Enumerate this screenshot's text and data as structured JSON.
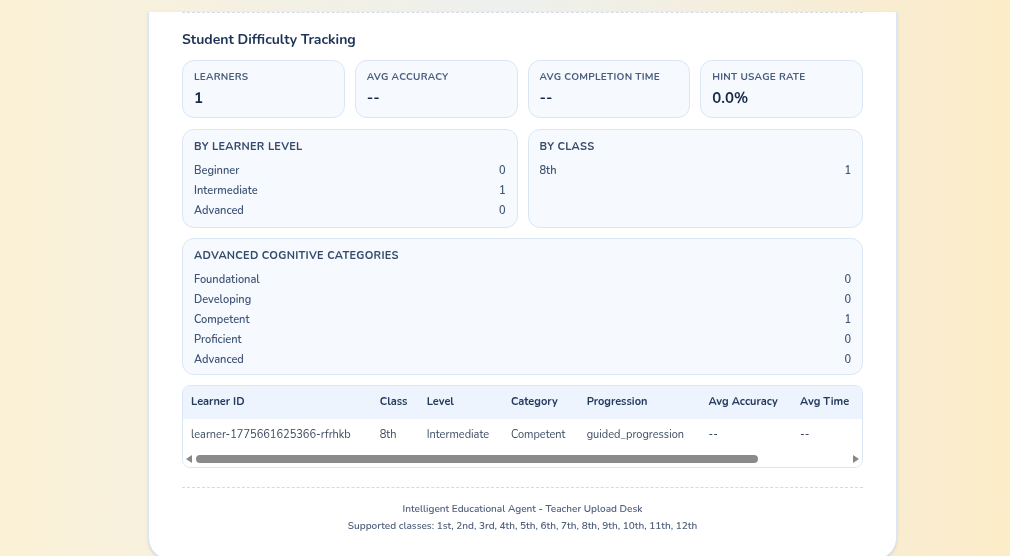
{
  "section_title": "Student Difficulty Tracking",
  "stats": [
    {
      "label": "LEARNERS",
      "value": "1"
    },
    {
      "label": "AVG ACCURACY",
      "value": "--"
    },
    {
      "label": "AVG COMPLETION TIME",
      "value": "--"
    },
    {
      "label": "HINT USAGE RATE",
      "value": "0.0%"
    }
  ],
  "by_learner_level": {
    "title": "BY LEARNER LEVEL",
    "rows": [
      {
        "label": "Beginner",
        "count": "0"
      },
      {
        "label": "Intermediate",
        "count": "1"
      },
      {
        "label": "Advanced",
        "count": "0"
      }
    ]
  },
  "by_class": {
    "title": "BY CLASS",
    "rows": [
      {
        "label": "8th",
        "count": "1"
      }
    ]
  },
  "cognitive_categories": {
    "title": "ADVANCED COGNITIVE CATEGORIES",
    "rows": [
      {
        "label": "Foundational",
        "count": "0"
      },
      {
        "label": "Developing",
        "count": "0"
      },
      {
        "label": "Competent",
        "count": "1"
      },
      {
        "label": "Proficient",
        "count": "0"
      },
      {
        "label": "Advanced",
        "count": "0"
      }
    ]
  },
  "table": {
    "columns": [
      "Learner ID",
      "Class",
      "Level",
      "Category",
      "Progression",
      "Avg Accuracy",
      "Avg Time"
    ],
    "rows": [
      [
        "learner-1775661625366-rfrhkb",
        "8th",
        "Intermediate",
        "Competent",
        "guided_progression",
        "--",
        "--"
      ]
    ]
  },
  "footer": [
    "Intelligent Educational Agent - Teacher Upload Desk",
    "Supported classes: 1st, 2nd, 3rd, 4th, 5th, 6th, 7th, 8th, 9th, 10th, 11th, 12th"
  ]
}
